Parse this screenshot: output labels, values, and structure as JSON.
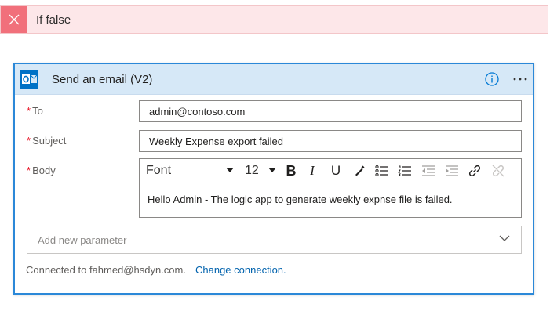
{
  "condition_branch": {
    "label": "If false"
  },
  "action": {
    "title": "Send an email (V2)",
    "fields": {
      "to": {
        "label": "To",
        "required_marker": "*",
        "value": "admin@contoso.com"
      },
      "subject": {
        "label": "Subject",
        "required_marker": "*",
        "value": "Weekly Expense export failed"
      },
      "body": {
        "label": "Body",
        "required_marker": "*",
        "font": "Font",
        "font_size": "12",
        "bold": "B",
        "italic": "I",
        "underline": "U",
        "value": "Hello Admin - The logic app to generate weekly expnse file is failed."
      }
    },
    "add_parameter_placeholder": "Add new parameter",
    "connection": {
      "text": "Connected to fahmed@hsdyn.com.",
      "change_link": "Change connection."
    }
  },
  "colors": {
    "accent": "#2b88d8",
    "header_bg": "#d6e8f7",
    "false_bar_bg": "#fde7e9",
    "false_icon_bg": "#f1707b",
    "link": "#0062ad",
    "required": "#e81123"
  },
  "icons": [
    "close-icon",
    "outlook-icon",
    "info-icon",
    "more-options-icon",
    "chevron-down-icon",
    "bold-icon",
    "italic-icon",
    "underline-icon",
    "highlight-icon",
    "bullet-list-icon",
    "numbered-list-icon",
    "decrease-indent-icon",
    "increase-indent-icon",
    "link-icon",
    "unlink-icon"
  ]
}
